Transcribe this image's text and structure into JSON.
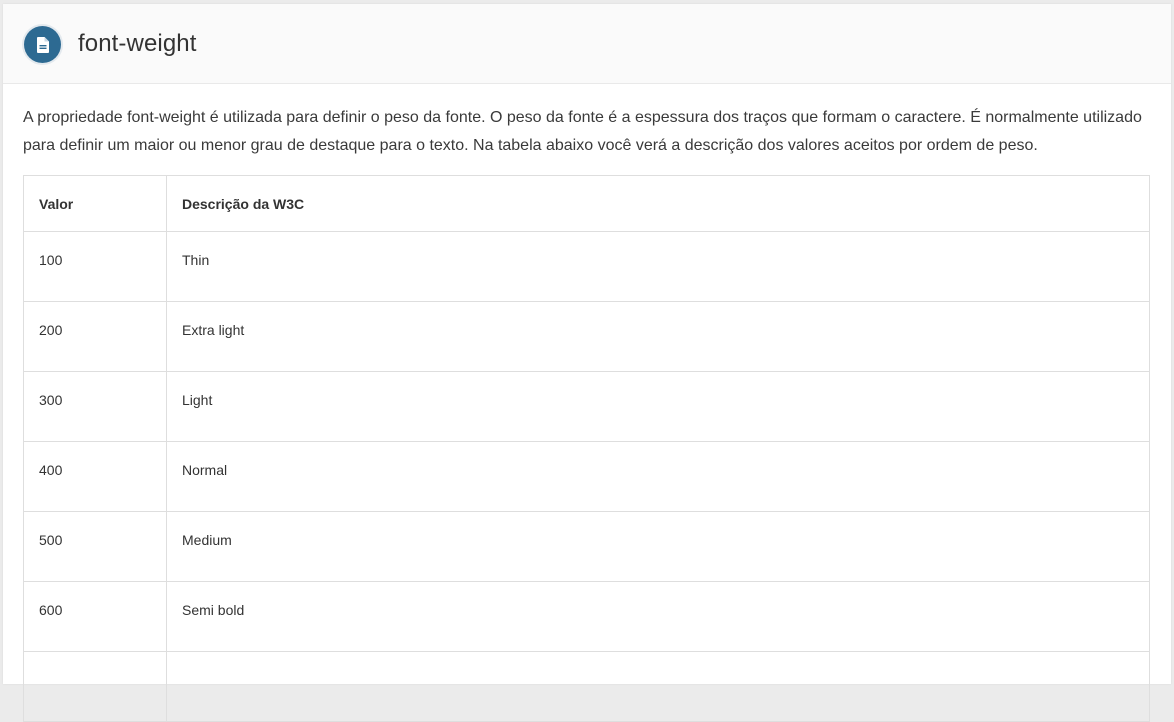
{
  "header": {
    "icon": "document-icon",
    "title": "font-weight",
    "icon_color": "#2d6a92"
  },
  "intro": "A propriedade font-weight é utilizada para definir o peso da fonte. O peso da fonte é a espessura dos traços que formam o caractere. É normalmente utilizado para definir um maior ou menor grau de destaque para o texto. Na tabela abaixo você verá a descrição dos valores aceitos por ordem de peso.",
  "table": {
    "headers": [
      "Valor",
      "Descrição da W3C"
    ],
    "rows": [
      {
        "value": "100",
        "description": "Thin"
      },
      {
        "value": "200",
        "description": "Extra light"
      },
      {
        "value": "300",
        "description": "Light"
      },
      {
        "value": "400",
        "description": "Normal"
      },
      {
        "value": "500",
        "description": "Medium"
      },
      {
        "value": "600",
        "description": "Semi bold"
      }
    ]
  }
}
